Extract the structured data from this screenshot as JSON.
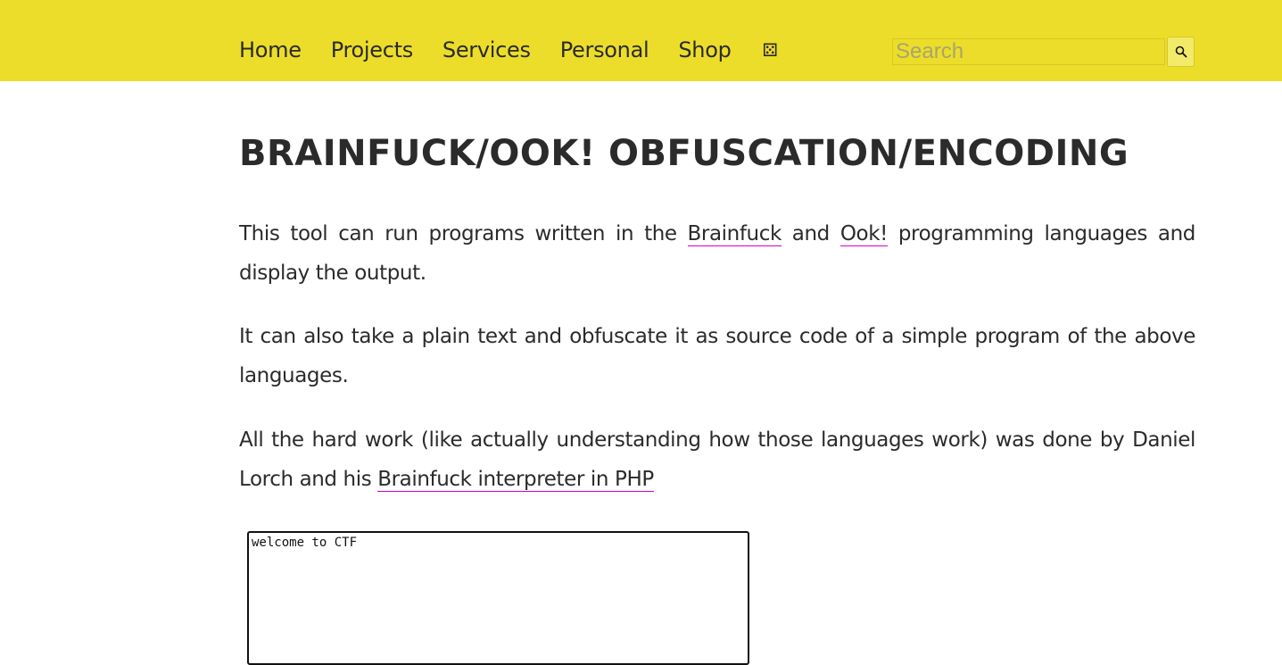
{
  "header": {
    "nav": [
      {
        "label": "Home"
      },
      {
        "label": "Projects"
      },
      {
        "label": "Services"
      },
      {
        "label": "Personal"
      },
      {
        "label": "Shop"
      },
      {
        "label": "⚄"
      }
    ],
    "search": {
      "placeholder": "Search",
      "value": ""
    },
    "icons": {
      "search_button": "magnifier-icon",
      "random": "dice-icon"
    },
    "colors": {
      "bar": "#ecdd2a",
      "link_underline": "#d400d4"
    }
  },
  "main": {
    "title": "Brainfuck/Ook! Obfuscation/Encoding",
    "p1": {
      "t1": "This tool can run programs written in the ",
      "link1": "Brainfuck",
      "t2": " and ",
      "link2": "Ook!",
      "t3": " programming languages and display the output."
    },
    "p2": {
      "text": "It can also take a plain text and obfuscate it as source code of a simple program of the above languages."
    },
    "p3": {
      "t1": "All the hard work (like actually understanding how those languages work) was done by Daniel Lorch and his ",
      "link": "Brainfuck interpreter in PHP"
    },
    "textarea": {
      "value": "welcome to CTF"
    }
  }
}
